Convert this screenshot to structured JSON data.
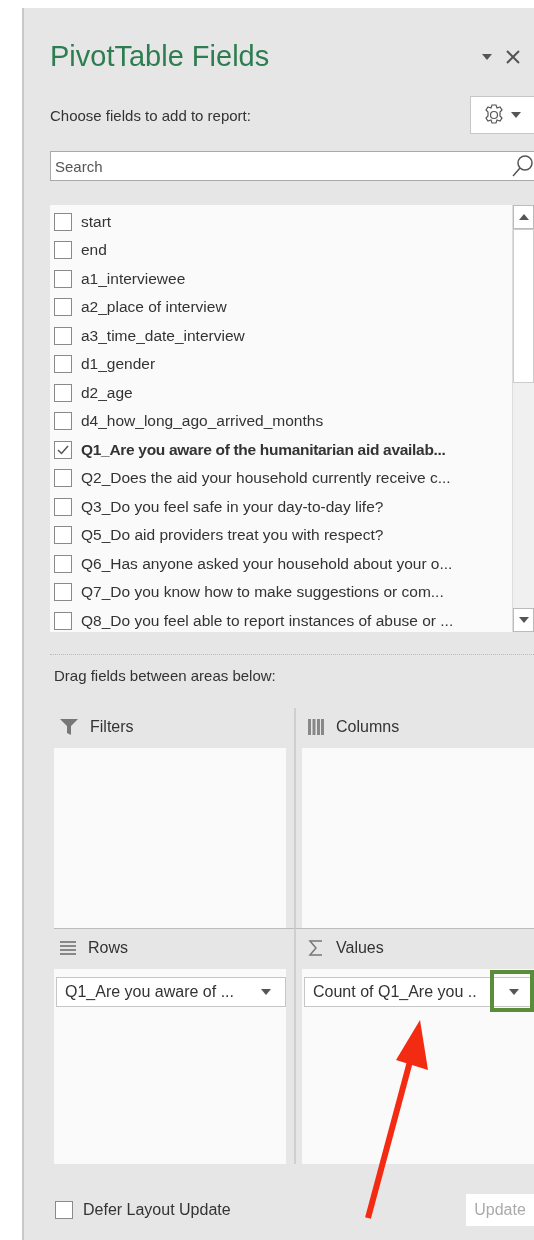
{
  "panel": {
    "title": "PivotTable Fields",
    "subtitle": "Choose fields to add to report:"
  },
  "search": {
    "placeholder": "Search"
  },
  "fields": [
    {
      "label": "start",
      "checked": false
    },
    {
      "label": "end",
      "checked": false
    },
    {
      "label": "a1_interviewee",
      "checked": false
    },
    {
      "label": "a2_place of interview",
      "checked": false
    },
    {
      "label": "a3_time_date_interview",
      "checked": false
    },
    {
      "label": "d1_gender",
      "checked": false
    },
    {
      "label": "d2_age",
      "checked": false
    },
    {
      "label": "d4_how_long_ago_arrived_months",
      "checked": false
    },
    {
      "label": "Q1_Are you aware of the humanitarian aid availab...",
      "checked": true
    },
    {
      "label": "Q2_Does the aid your household currently receive c...",
      "checked": false
    },
    {
      "label": "Q3_Do you feel safe in your day-to-day life?",
      "checked": false
    },
    {
      "label": "Q5_Do aid providers treat you with respect?",
      "checked": false
    },
    {
      "label": "Q6_Has anyone asked your household about your o...",
      "checked": false
    },
    {
      "label": "Q7_Do you know how to make suggestions or com...",
      "checked": false
    },
    {
      "label": "Q8_Do you feel able to report instances of abuse or ...",
      "checked": false
    }
  ],
  "areas_hint": "Drag fields between areas below:",
  "areas": [
    {
      "kind": "filters",
      "title": "Filters"
    },
    {
      "kind": "columns",
      "title": "Columns"
    },
    {
      "kind": "rows",
      "title": "Rows",
      "items": [
        {
          "label": "Q1_Are you aware of ...",
          "highlighted": false
        }
      ]
    },
    {
      "kind": "values",
      "title": "Values",
      "items": [
        {
          "label": "Count of Q1_Are you ..",
          "highlighted": true
        }
      ]
    }
  ],
  "footer": {
    "defer_label": "Defer Layout Update",
    "defer_checked": false,
    "update_label": "Update",
    "update_disabled": true
  }
}
